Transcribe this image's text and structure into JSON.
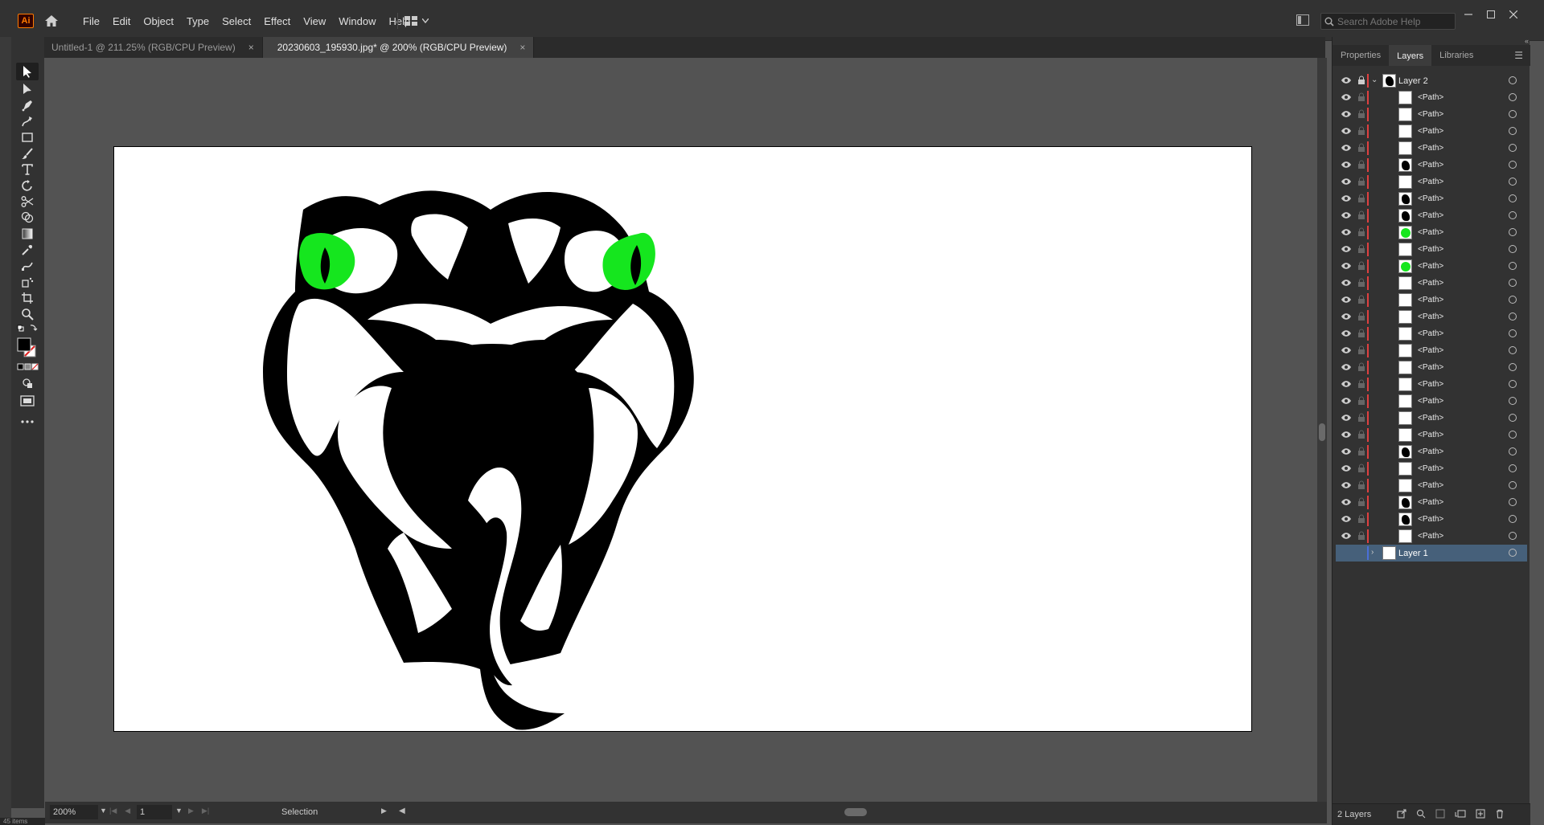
{
  "app": {
    "logo_text": "Ai"
  },
  "menu": [
    "File",
    "Edit",
    "Object",
    "Type",
    "Select",
    "Effect",
    "View",
    "Window",
    "Help"
  ],
  "search": {
    "placeholder": "Search Adobe Help"
  },
  "tabs": [
    {
      "label": "Untitled-1 @ 211.25% (RGB/CPU Preview)",
      "close": "×",
      "active": false
    },
    {
      "label": "20230603_195930.jpg* @ 200% (RGB/CPU Preview)",
      "close": "×",
      "active": true
    }
  ],
  "tools": [
    "selection-tool",
    "direct-selection-tool",
    "pen-tool",
    "curvature-tool",
    "rectangle-tool",
    "paintbrush-tool",
    "type-tool",
    "rotate-tool",
    "scissors-tool",
    "shape-builder-tool",
    "gradient-tool",
    "eyedropper-tool",
    "blend-tool",
    "symbol-sprayer-tool",
    "artboard-tool",
    "zoom-tool"
  ],
  "colors": {
    "fill": "#000000",
    "stroke": "none",
    "accent_green": "#15e61e",
    "panel_bg": "#323232",
    "canvas_bg": "#535353"
  },
  "statusbar": {
    "zoom": "200%",
    "page": "1",
    "tool": "Selection"
  },
  "panel": {
    "tabs": [
      "Properties",
      "Layers",
      "Libraries"
    ],
    "active_tab": "Layers",
    "layer2": {
      "name": "Layer 2"
    },
    "paths": [
      {
        "name": "<Path>",
        "thumb": "white"
      },
      {
        "name": "<Path>",
        "thumb": "white"
      },
      {
        "name": "<Path>",
        "thumb": "white"
      },
      {
        "name": "<Path>",
        "thumb": "white"
      },
      {
        "name": "<Path>",
        "thumb": "black"
      },
      {
        "name": "<Path>",
        "thumb": "white"
      },
      {
        "name": "<Path>",
        "thumb": "black"
      },
      {
        "name": "<Path>",
        "thumb": "black"
      },
      {
        "name": "<Path>",
        "thumb": "green"
      },
      {
        "name": "<Path>",
        "thumb": "white"
      },
      {
        "name": "<Path>",
        "thumb": "green"
      },
      {
        "name": "<Path>",
        "thumb": "white"
      },
      {
        "name": "<Path>",
        "thumb": "white"
      },
      {
        "name": "<Path>",
        "thumb": "white"
      },
      {
        "name": "<Path>",
        "thumb": "white"
      },
      {
        "name": "<Path>",
        "thumb": "white"
      },
      {
        "name": "<Path>",
        "thumb": "white"
      },
      {
        "name": "<Path>",
        "thumb": "white"
      },
      {
        "name": "<Path>",
        "thumb": "white"
      },
      {
        "name": "<Path>",
        "thumb": "white"
      },
      {
        "name": "<Path>",
        "thumb": "white"
      },
      {
        "name": "<Path>",
        "thumb": "black"
      },
      {
        "name": "<Path>",
        "thumb": "white"
      },
      {
        "name": "<Path>",
        "thumb": "white"
      },
      {
        "name": "<Path>",
        "thumb": "black"
      },
      {
        "name": "<Path>",
        "thumb": "black"
      },
      {
        "name": "<Path>",
        "thumb": "white"
      }
    ],
    "layer1": {
      "name": "Layer 1"
    },
    "footer_count": "2 Layers"
  },
  "bottom_left": "45 items"
}
